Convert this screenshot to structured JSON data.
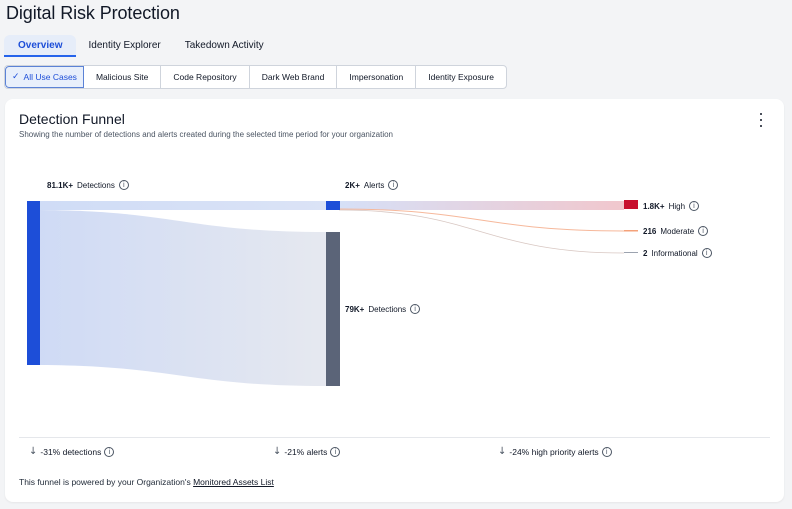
{
  "page": {
    "title": "Digital Risk Protection"
  },
  "tabs": [
    {
      "label": "Overview",
      "active": true
    },
    {
      "label": "Identity Explorer"
    },
    {
      "label": "Takedown Activity"
    }
  ],
  "filters": [
    {
      "label": "All Use Cases",
      "active": true
    },
    {
      "label": "Malicious Site"
    },
    {
      "label": "Code Repository"
    },
    {
      "label": "Dark Web Brand"
    },
    {
      "label": "Impersonation"
    },
    {
      "label": "Identity Exposure"
    }
  ],
  "card": {
    "title": "Detection Funnel",
    "subtitle": "Showing the number of detections and alerts created during the selected time period for your organization"
  },
  "funnel": {
    "detections_total": {
      "value": "81.1K+",
      "label": "Detections"
    },
    "alerts": {
      "value": "2K+",
      "label": "Alerts"
    },
    "detections_remaining": {
      "value": "79K+",
      "label": "Detections"
    },
    "severity": [
      {
        "value": "1.8K+",
        "label": "High",
        "color": "#c8102e"
      },
      {
        "value": "216",
        "label": "Moderate",
        "color": "#f4a27a"
      },
      {
        "value": "2",
        "label": "Informational",
        "color": "#9ca3af"
      }
    ],
    "colors": {
      "primary": "#1d4ed8",
      "secondary": "#5b6478",
      "flow": "#dbe4f7"
    }
  },
  "stats": [
    {
      "text": "-31% detections"
    },
    {
      "text": "-21% alerts"
    },
    {
      "text": "-24% high priority alerts"
    }
  ],
  "footer": {
    "prefix": "This funnel is powered by your Organization's ",
    "link": "Monitored Assets List"
  }
}
